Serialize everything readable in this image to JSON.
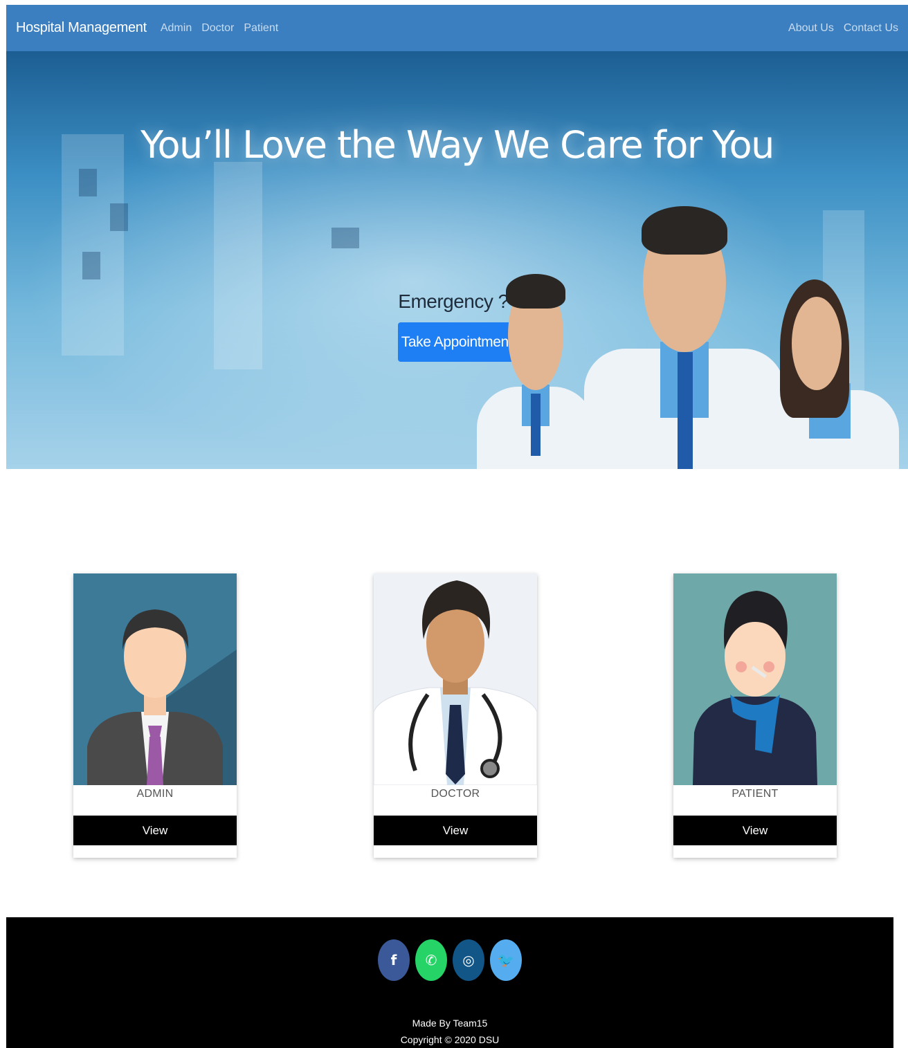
{
  "navbar": {
    "brand": "Hospital Management",
    "left_links": [
      "Admin",
      "Doctor",
      "Patient"
    ],
    "right_links": [
      "About Us",
      "Contact Us"
    ],
    "color": "#3b7fc0"
  },
  "hero": {
    "title": "You’ll Love the Way We Care for You",
    "emergency_text": "Emergency ?",
    "appointment_button": "Take Appointment",
    "button_color": "#1e7ef3"
  },
  "cards": [
    {
      "label": "ADMIN",
      "button": "View",
      "image": "admin-avatar-icon",
      "bg": "#3d7a98"
    },
    {
      "label": "DOCTOR",
      "button": "View",
      "image": "doctor-avatar-icon",
      "bg": "#eef1f6"
    },
    {
      "label": "PATIENT",
      "button": "View",
      "image": "patient-avatar-icon",
      "bg": "#6fa8a8"
    }
  ],
  "footer": {
    "social": [
      {
        "name": "facebook-icon",
        "glyph": "f",
        "color": "#3b5998"
      },
      {
        "name": "whatsapp-icon",
        "glyph": "✆",
        "color": "#25d366"
      },
      {
        "name": "instagram-icon",
        "glyph": "◎",
        "color": "#125688"
      },
      {
        "name": "twitter-icon",
        "glyph": "🐦",
        "color": "#55acee"
      }
    ],
    "made_by": "Made By Team15",
    "copyright": "Copyright © 2020 DSU"
  }
}
